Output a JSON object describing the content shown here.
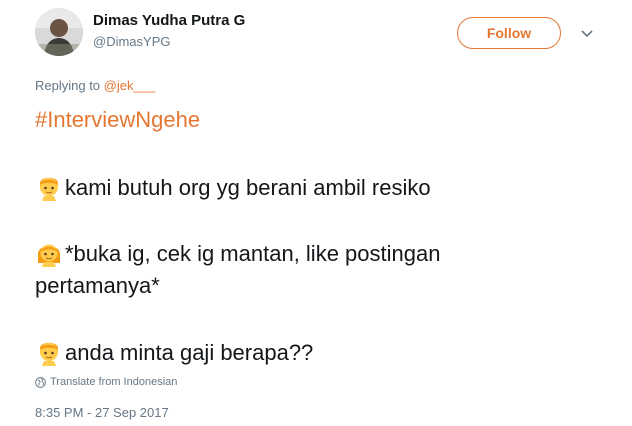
{
  "author": {
    "name": "Dimas Yudha Putra G",
    "handle": "@DimasYPG"
  },
  "follow_label": "Follow",
  "reply": {
    "prefix": "Replying to ",
    "mention": "@jek___"
  },
  "tweet": {
    "hashtag": "#InterviewNgehe",
    "line1": "kami butuh org yg berani ambil resiko",
    "line2a": "*buka ig, cek ig mantan, like postingan",
    "line2b": "pertamanya*",
    "line3": "anda minta gaji berapa??"
  },
  "translate_label": "Translate from Indonesian",
  "timestamp": "8:35 PM - 27 Sep 2017",
  "colors": {
    "accent": "#e57733",
    "text": "#14171a",
    "secondary": "#657786"
  },
  "icons": [
    "avatar-photo",
    "chevron-down-icon",
    "man-emoji",
    "woman-emoji",
    "globe-icon"
  ]
}
